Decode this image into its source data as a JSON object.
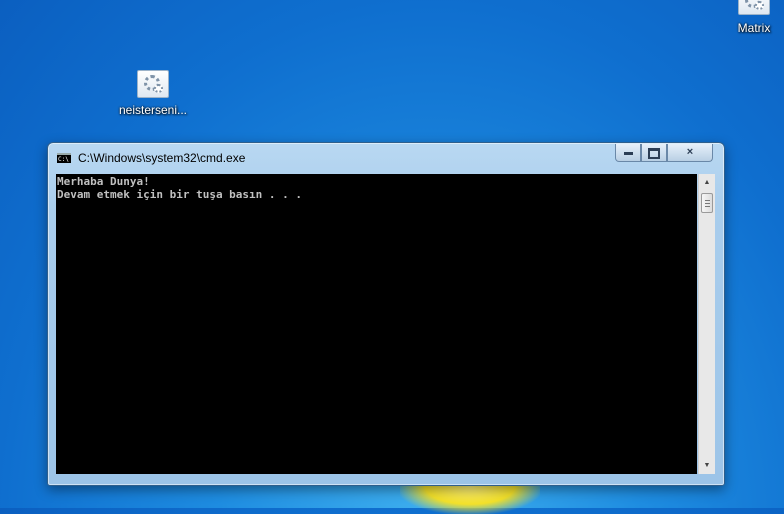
{
  "desktop": {
    "icons": [
      {
        "label": "neisterseni..."
      },
      {
        "label": "Matrix"
      }
    ]
  },
  "window": {
    "title": "C:\\Windows\\system32\\cmd.exe",
    "icon": "cmd-icon",
    "controls": {
      "minimize": "minimize-icon",
      "maximize": "maximize-icon",
      "close": "×"
    }
  },
  "console": {
    "lines": [
      "Merhaba Dunya!",
      "Devam etmek için bir tuşa basın . . ."
    ]
  },
  "scrollbar": {
    "up": "▲",
    "down": "▼"
  }
}
